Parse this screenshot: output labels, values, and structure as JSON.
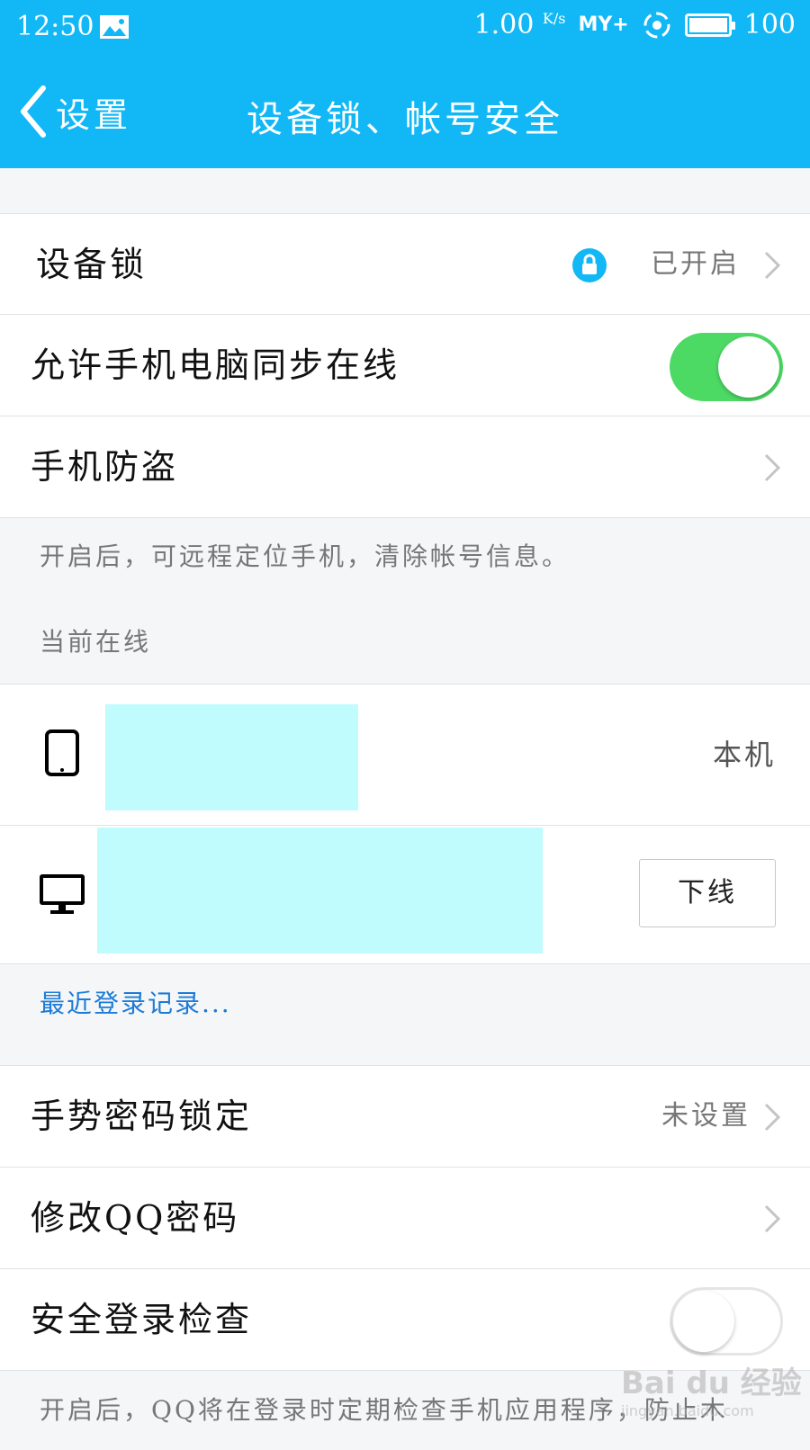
{
  "status_bar": {
    "time": "12:50",
    "net_speed": "1.00",
    "net_speed_unit": "K/s",
    "carrier": "MY+",
    "battery": "100"
  },
  "nav": {
    "back_label": "设置",
    "title": "设备锁、帐号安全"
  },
  "rows": {
    "device_lock": {
      "label": "设备锁",
      "value": "已开启"
    },
    "sync_online": {
      "label": "允许手机电脑同步在线",
      "enabled": true
    },
    "anti_theft": {
      "label": "手机防盗"
    }
  },
  "anti_theft_desc": "开启后，可远程定位手机，清除帐号信息。",
  "online_header": "当前在线",
  "devices": {
    "phone_tag": "本机",
    "pc_button": "下线"
  },
  "recent_login_link": "最近登录记录...",
  "security": {
    "gesture_lock": {
      "label": "手势密码锁定",
      "value": "未设置"
    },
    "change_password": {
      "label": "修改QQ密码"
    },
    "safe_login_check": {
      "label": "安全登录检查",
      "enabled": false
    }
  },
  "safe_login_desc": "开启后，QQ将在登录时定期检查手机应用程序，防止木",
  "watermark": {
    "brand": "Bai du 经验",
    "url": "jingyan.baidu.com"
  },
  "colors": {
    "accent": "#12b7f5",
    "toggle_on": "#4cd964",
    "link": "#1b7bd6",
    "mask": "#c0fbfd"
  }
}
